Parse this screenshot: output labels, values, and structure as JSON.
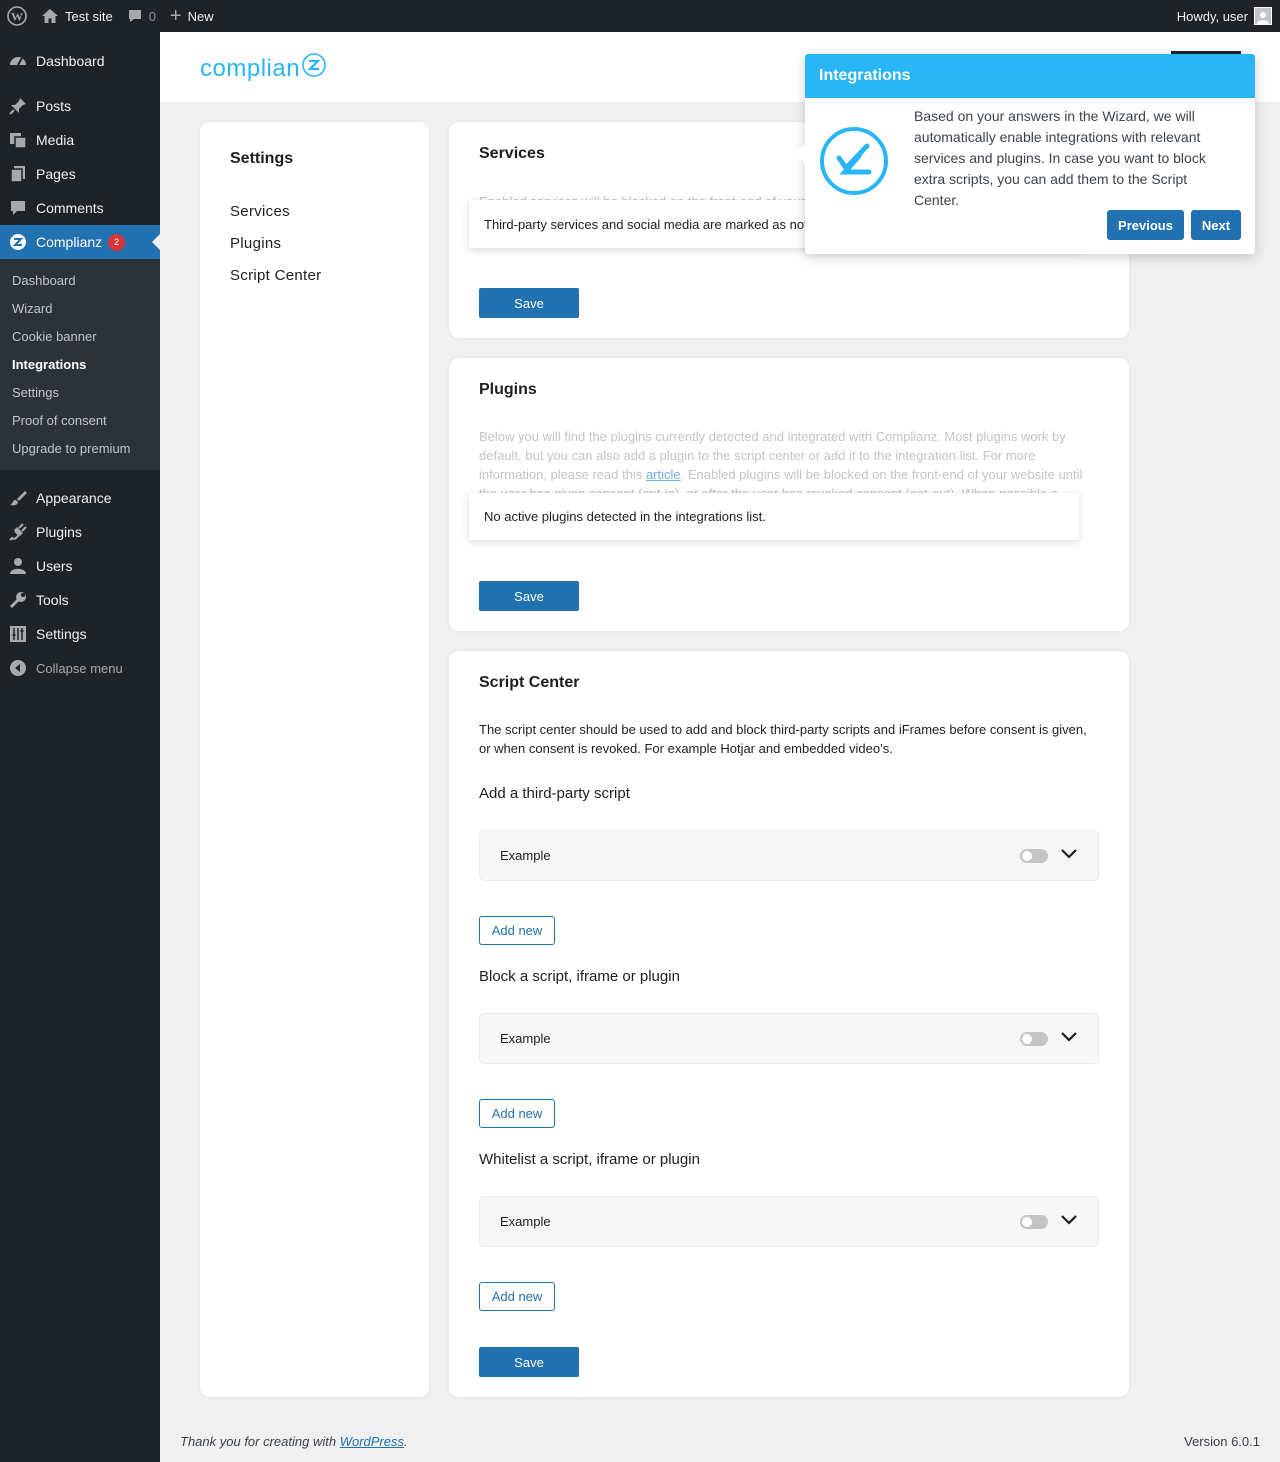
{
  "adminbar": {
    "site_name": "Test site",
    "comments_count": "0",
    "new_label": "New",
    "howdy": "Howdy, user"
  },
  "sidebar": {
    "items_top": [
      {
        "label": "Dashboard",
        "icon": "dashboard-icon"
      }
    ],
    "items_mid": [
      {
        "label": "Posts",
        "icon": "pin-icon"
      },
      {
        "label": "Media",
        "icon": "media-icon"
      },
      {
        "label": "Pages",
        "icon": "pages-icon"
      },
      {
        "label": "Comments",
        "icon": "comment-icon"
      }
    ],
    "complianz": {
      "label": "Complianz",
      "badge": "2"
    },
    "submenu": [
      "Dashboard",
      "Wizard",
      "Cookie banner",
      "Integrations",
      "Settings",
      "Proof of consent",
      "Upgrade to premium"
    ],
    "items_bottom": [
      {
        "label": "Appearance"
      },
      {
        "label": "Plugins"
      },
      {
        "label": "Users"
      },
      {
        "label": "Tools"
      },
      {
        "label": "Settings"
      }
    ],
    "collapse_label": "Collapse menu"
  },
  "header": {
    "logo_text": "complian"
  },
  "settings_menu": {
    "title": "Settings",
    "links": [
      "Services",
      "Plugins",
      "Script Center"
    ]
  },
  "services": {
    "title": "Services",
    "faded_text": "Enabled services will be blocked on the front-end of your",
    "notice": "Third-party services and social media are marked as not",
    "save": "Save"
  },
  "plugins": {
    "title": "Plugins",
    "faded_pre": "Below you will find the plugins currently detected and integrated with Complianz. Most plugins work by default, but you can also add a plugin to the script center or add it to the integration list. For more information, please read this ",
    "faded_link": "article",
    "faded_post": ". Enabled plugins will be blocked on the front-end of your website until the user has given consent (opt-in), or after the user has revoked consent (opt-out). When possible a",
    "notice": "No active plugins detected in the integrations list.",
    "save": "Save"
  },
  "script_center": {
    "title": "Script Center",
    "description": "The script center should be used to add and block third-party scripts and iFrames before consent is given, or when consent is revoked. For example Hotjar and embedded video’s.",
    "sections": [
      {
        "label": "Add a third-party script",
        "panel": "Example",
        "add": "Add new"
      },
      {
        "label": "Block a script, iframe or plugin",
        "panel": "Example",
        "add": "Add new"
      },
      {
        "label": "Whitelist a script, iframe or plugin",
        "panel": "Example",
        "add": "Add new"
      }
    ],
    "save": "Save"
  },
  "popover": {
    "title": "Integrations",
    "close_glyph": "",
    "text": "Based on your answers in the Wizard, we will automatically enable integrations with relevant services and plugins. In case you want to block extra scripts, you can add them to the Script Center.",
    "previous": "Previous",
    "next": "Next"
  },
  "footer": {
    "thanks_pre": "Thank you for creating with ",
    "thanks_link": "WordPress",
    "thanks_post": ".",
    "version": "Version 6.0.1"
  },
  "colors": {
    "accent": "#2271b1",
    "complianz_blue": "#29b6f6",
    "sidebar_bg": "#1d2327"
  }
}
